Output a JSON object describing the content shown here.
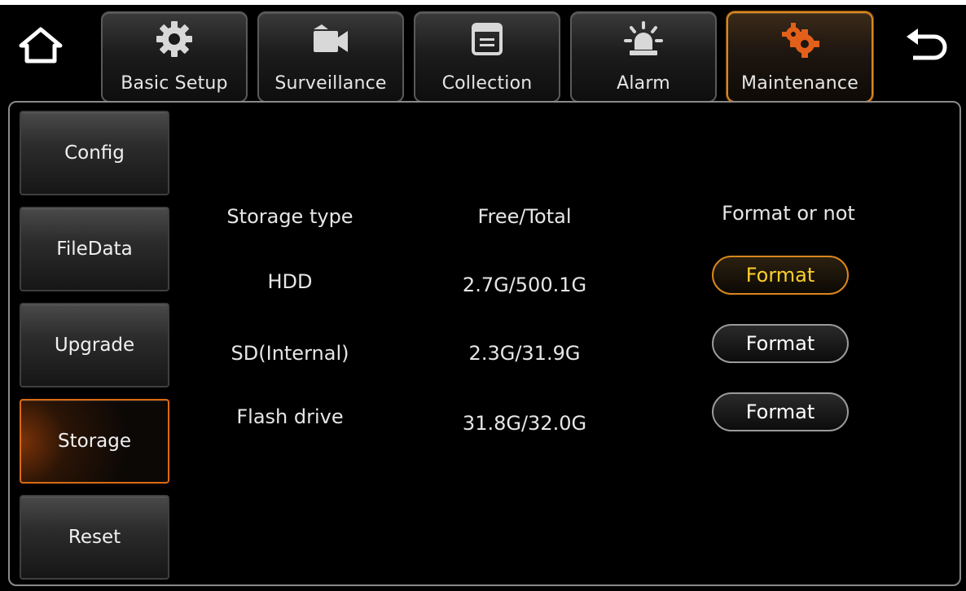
{
  "tabs": [
    {
      "label": "Basic Setup",
      "icon": "gear-icon"
    },
    {
      "label": "Surveillance",
      "icon": "video-camera-icon"
    },
    {
      "label": "Collection",
      "icon": "window-icon"
    },
    {
      "label": "Alarm",
      "icon": "alarm-light-icon"
    },
    {
      "label": "Maintenance",
      "icon": "maintenance-gears-icon",
      "active": true
    }
  ],
  "icons": {
    "home": "home-icon",
    "back": "back-arrow-icon"
  },
  "sidebar": {
    "items": [
      {
        "label": "Config"
      },
      {
        "label": "FileData"
      },
      {
        "label": "Upgrade"
      },
      {
        "label": "Storage",
        "active": true
      },
      {
        "label": "Reset"
      }
    ]
  },
  "storage": {
    "headers": {
      "type": "Storage type",
      "space": "Free/Total",
      "format": "Format or not"
    },
    "rows": [
      {
        "type": "HDD",
        "space": "2.7G/500.1G",
        "button": "Format"
      },
      {
        "type": "SD(Internal)",
        "space": "2.3G/31.9G",
        "button": "Format"
      },
      {
        "type": "Flash drive",
        "space": "31.8G/32.0G",
        "button": "Format"
      }
    ]
  },
  "colors": {
    "accent": "#d9871e",
    "focus_text": "#ffcf2a",
    "background": "#000000"
  }
}
